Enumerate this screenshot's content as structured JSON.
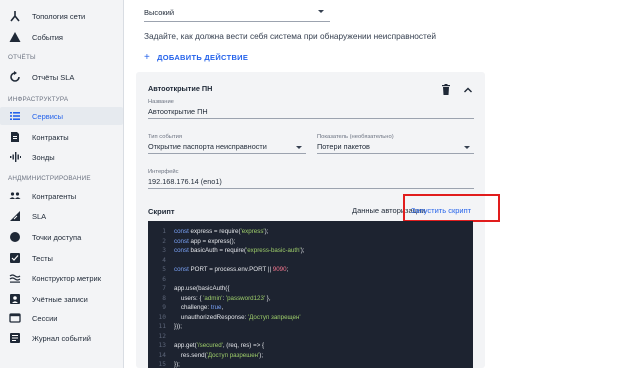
{
  "sidebar": {
    "items": [
      {
        "label": "Топология сети",
        "icon": "topology-icon"
      },
      {
        "label": "События",
        "icon": "warning-icon"
      },
      {
        "label": "Отчёты SLA",
        "icon": "refresh-icon"
      },
      {
        "label": "Сервисы",
        "icon": "list-icon",
        "active": true
      },
      {
        "label": "Контракты",
        "icon": "document-icon"
      },
      {
        "label": "Зонды",
        "icon": "probe-icon"
      },
      {
        "label": "Контрагенты",
        "icon": "people-icon"
      },
      {
        "label": "SLA",
        "icon": "sla-icon"
      },
      {
        "label": "Точки доступа",
        "icon": "dot-icon"
      },
      {
        "label": "Тесты",
        "icon": "test-icon"
      },
      {
        "label": "Конструктор метрик",
        "icon": "metric-icon"
      },
      {
        "label": "Учётные записи",
        "icon": "account-icon"
      },
      {
        "label": "Сессии",
        "icon": "session-icon"
      },
      {
        "label": "Журнал событий",
        "icon": "journal-icon"
      }
    ],
    "sections": {
      "reports": "ОТЧЁТЫ",
      "infrastructure": "ИНФРАСТРУКТУРА",
      "administration": "АНДМИНИСТРИРОВАНИЕ"
    }
  },
  "main": {
    "severity_value": "Высокий",
    "description": "Задайте, как должна вести себя система при обнаружении неисправностей",
    "add_action": "ДОБАВИТЬ ДЕЙСТВИЕ",
    "card": {
      "title": "Автооткрытие ПН",
      "name_label": "Название",
      "name_value": "Автооткрытие ПН",
      "event_type_label": "Тип события",
      "event_type_value": "Открытие паспорта неисправности",
      "metric_label": "Показатель (необязательно)",
      "metric_value": "Потери пакетов",
      "interface_label": "Интерфейс",
      "interface_value": "192.168.176.14 (eno1)",
      "script_label": "Скрипт",
      "auth_data_link": "Данные авторизации",
      "run_script": "Запустить скрипт"
    },
    "code_lines": [
      {
        "n": "1",
        "parts": [
          [
            "k",
            "const "
          ],
          [
            "t",
            "express = require("
          ],
          [
            "s",
            "'express'"
          ],
          [
            "t",
            ");"
          ]
        ]
      },
      {
        "n": "2",
        "parts": [
          [
            "k",
            "const "
          ],
          [
            "t",
            "app = express();"
          ]
        ]
      },
      {
        "n": "3",
        "parts": [
          [
            "k",
            "const "
          ],
          [
            "t",
            "basicAuth = require("
          ],
          [
            "s",
            "'express-basic-auth'"
          ],
          [
            "t",
            ");"
          ]
        ]
      },
      {
        "n": "4",
        "parts": []
      },
      {
        "n": "5",
        "parts": [
          [
            "k",
            "const "
          ],
          [
            "t",
            "PORT = process.env.PORT || "
          ],
          [
            "n",
            "9090"
          ],
          [
            "t",
            ";"
          ]
        ]
      },
      {
        "n": "6",
        "parts": []
      },
      {
        "n": "7",
        "parts": [
          [
            "t",
            "app.use(basicAuth({"
          ]
        ]
      },
      {
        "n": "8",
        "parts": [
          [
            "t",
            "    users: { "
          ],
          [
            "s",
            "'admin'"
          ],
          [
            "t",
            ": "
          ],
          [
            "s",
            "'password123'"
          ],
          [
            "t",
            " },"
          ]
        ]
      },
      {
        "n": "9",
        "parts": [
          [
            "t",
            "    challenge: "
          ],
          [
            "k",
            "true"
          ],
          [
            "t",
            ","
          ]
        ]
      },
      {
        "n": "10",
        "parts": [
          [
            "t",
            "    unauthorizedResponse: "
          ],
          [
            "s",
            "'Доступ запрещен'"
          ]
        ]
      },
      {
        "n": "11",
        "parts": [
          [
            "t",
            "}));"
          ]
        ]
      },
      {
        "n": "12",
        "parts": []
      },
      {
        "n": "13",
        "parts": [
          [
            "t",
            "app.get("
          ],
          [
            "s",
            "'/secured'"
          ],
          [
            "t",
            ", (req, res) => {"
          ]
        ]
      },
      {
        "n": "14",
        "parts": [
          [
            "t",
            "    res.send("
          ],
          [
            "s",
            "'Доступ разрешен'"
          ],
          [
            "t",
            ");"
          ]
        ]
      },
      {
        "n": "15",
        "parts": [
          [
            "t",
            "});"
          ]
        ]
      }
    ]
  }
}
